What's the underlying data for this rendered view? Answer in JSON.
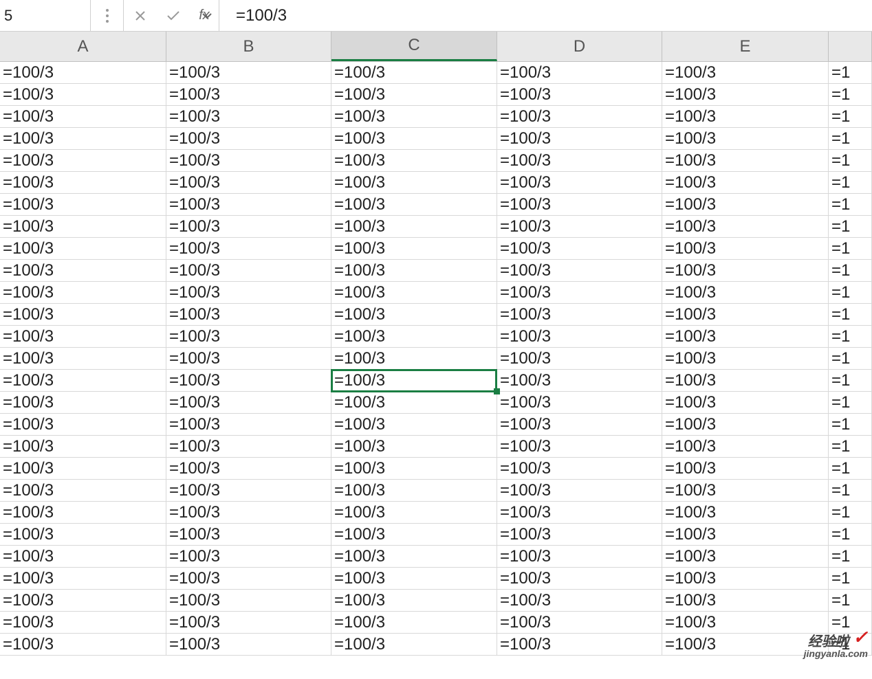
{
  "formula_bar": {
    "name_box_value": "5",
    "fx_label": "fx",
    "formula_value": "=100/3"
  },
  "columns": [
    {
      "label": "A",
      "class": "col-a",
      "selected": false
    },
    {
      "label": "B",
      "class": "col-b",
      "selected": false
    },
    {
      "label": "C",
      "class": "col-c",
      "selected": true
    },
    {
      "label": "D",
      "class": "col-d",
      "selected": false
    },
    {
      "label": "E",
      "class": "col-e",
      "selected": false
    },
    {
      "label": "",
      "class": "col-f",
      "selected": false
    }
  ],
  "cell_value": "=100/3",
  "partial_cell_value": "=1",
  "row_count": 27,
  "selected": {
    "row_index": 14,
    "col_index": 2
  },
  "watermark": {
    "title": "经验啦",
    "check": "✓",
    "url": "jingyanla.com"
  }
}
